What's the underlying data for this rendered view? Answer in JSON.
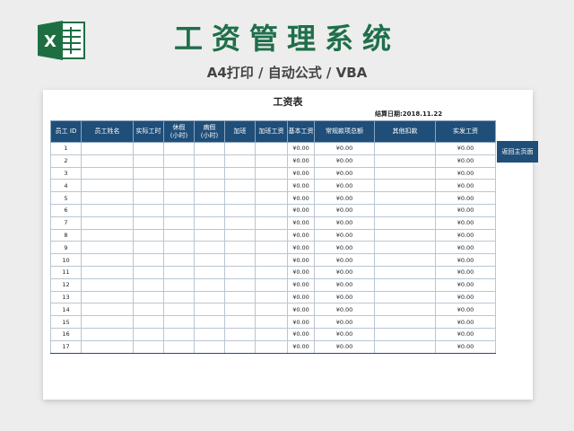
{
  "header": {
    "title": "工资管理系统",
    "subtitle": "A4打印 / 自动公式 / VBA",
    "logo_icon": "excel-icon",
    "logo_color": "#1d6f42"
  },
  "sheet": {
    "title": "工资表",
    "settle_date": "结算日期:2018.11.22",
    "columns": [
      "员工 ID",
      "员工姓名",
      "实际工时",
      "休假\n(小时)",
      "病假\n(小时)",
      "加班",
      "加班工资",
      "基本工资",
      "常规款项总额",
      "其他扣款",
      "实发工资"
    ],
    "rows": [
      {
        "id": "1",
        "basic": "¥0.00",
        "regular": "¥0.00",
        "net": "¥0.00"
      },
      {
        "id": "2",
        "basic": "¥0.00",
        "regular": "¥0.00",
        "net": "¥0.00"
      },
      {
        "id": "3",
        "basic": "¥0.00",
        "regular": "¥0.00",
        "net": "¥0.00"
      },
      {
        "id": "4",
        "basic": "¥0.00",
        "regular": "¥0.00",
        "net": "¥0.00"
      },
      {
        "id": "5",
        "basic": "¥0.00",
        "regular": "¥0.00",
        "net": "¥0.00"
      },
      {
        "id": "6",
        "basic": "¥0.00",
        "regular": "¥0.00",
        "net": "¥0.00"
      },
      {
        "id": "7",
        "basic": "¥0.00",
        "regular": "¥0.00",
        "net": "¥0.00"
      },
      {
        "id": "8",
        "basic": "¥0.00",
        "regular": "¥0.00",
        "net": "¥0.00"
      },
      {
        "id": "9",
        "basic": "¥0.00",
        "regular": "¥0.00",
        "net": "¥0.00"
      },
      {
        "id": "10",
        "basic": "¥0.00",
        "regular": "¥0.00",
        "net": "¥0.00"
      },
      {
        "id": "11",
        "basic": "¥0.00",
        "regular": "¥0.00",
        "net": "¥0.00"
      },
      {
        "id": "12",
        "basic": "¥0.00",
        "regular": "¥0.00",
        "net": "¥0.00"
      },
      {
        "id": "13",
        "basic": "¥0.00",
        "regular": "¥0.00",
        "net": "¥0.00"
      },
      {
        "id": "14",
        "basic": "¥0.00",
        "regular": "¥0.00",
        "net": "¥0.00"
      },
      {
        "id": "15",
        "basic": "¥0.00",
        "regular": "¥0.00",
        "net": "¥0.00"
      },
      {
        "id": "16",
        "basic": "¥0.00",
        "regular": "¥0.00",
        "net": "¥0.00"
      },
      {
        "id": "17",
        "basic": "¥0.00",
        "regular": "¥0.00",
        "net": "¥0.00"
      }
    ],
    "back_button": "返回主页面",
    "header_color": "#1f4e79"
  }
}
